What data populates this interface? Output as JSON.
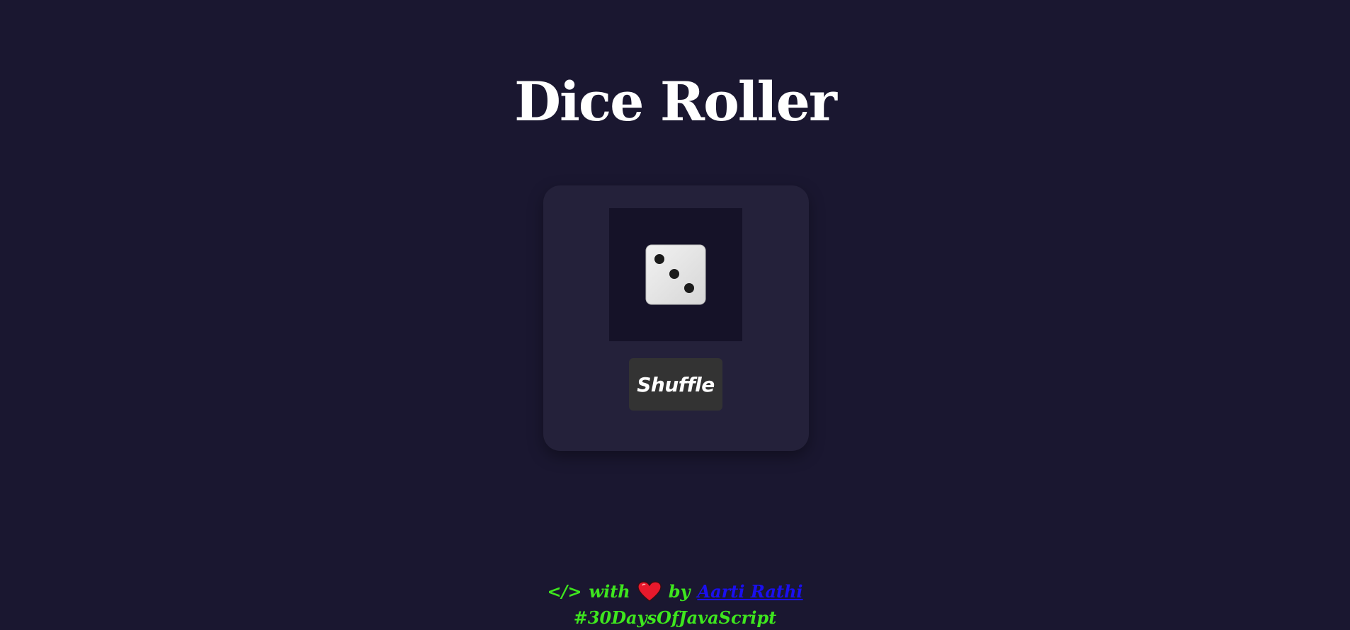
{
  "header": {
    "title": "Dice Roller"
  },
  "dice": {
    "face_value": 3,
    "icon": "dice-face-3-icon"
  },
  "controls": {
    "shuffle_label": "Shuffle"
  },
  "footer": {
    "code_symbol": "</>",
    "with_text": "with",
    "heart_icon": "heart-icon",
    "by_text": "by",
    "author_name": "Aarti Rathi",
    "hashtag": "#30DaysOfJavaScript"
  },
  "colors": {
    "background": "#1a1730",
    "card": "#24213a",
    "footer_text": "#3ee61e",
    "link": "#1a0ff0",
    "heart": "#e8192c"
  }
}
